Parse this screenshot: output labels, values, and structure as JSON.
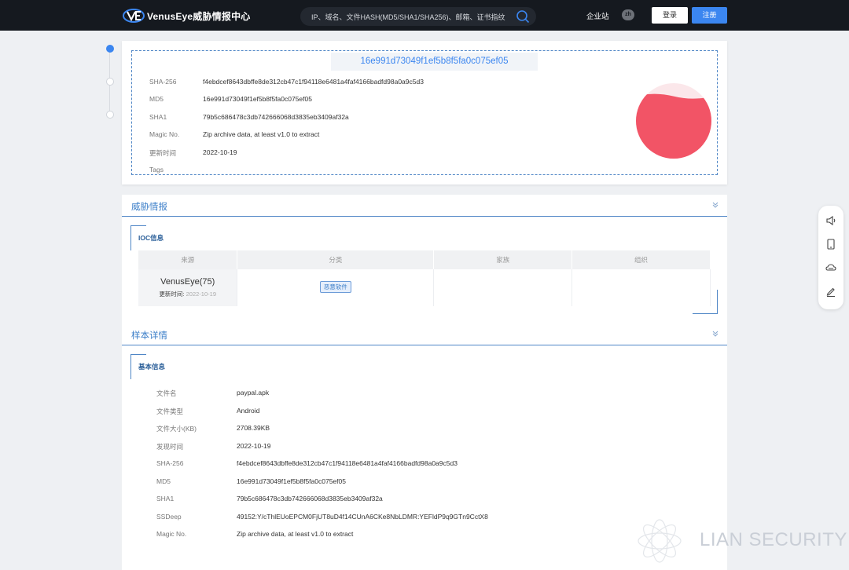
{
  "header": {
    "logo_text": "VenusEye威胁情报中心",
    "search_placeholder": "IP、域名、文件HASH(MD5/SHA1/SHA256)、邮箱、证书指纹",
    "enterprise_label": "企业站",
    "lang_label": "zh",
    "login_label": "登录",
    "register_label": "注册"
  },
  "summary": {
    "hash_title": "16e991d73049f1ef5b8f5fa0c075ef05",
    "rows": [
      {
        "key": "SHA-256",
        "value": "f4ebdcef8643dbffe8de312cb47c1f94118e6481a4faf4166badfd98a0a9c5d3"
      },
      {
        "key": "MD5",
        "value": "16e991d73049f1ef5b8f5fa0c075ef05"
      },
      {
        "key": "SHA1",
        "value": "79b5c686478c3db742666068d3835eb3409af32a"
      },
      {
        "key": "Magic No.",
        "value": "Zip archive data, at least v1.0 to extract"
      },
      {
        "key": "更新时间",
        "value": "2022-10-19"
      },
      {
        "key": "Tags",
        "value": ""
      }
    ],
    "gauge_color": "#f25466",
    "gauge_fill_fraction": 0.82
  },
  "threat": {
    "section_title": "威胁情报",
    "ioc_title": "IOC信息",
    "columns": [
      "来源",
      "分类",
      "家族",
      "组织"
    ],
    "row": {
      "source": "VenusEye(75)",
      "updated_label": "更新时间:",
      "updated_value": "2022-10-19",
      "category_tag": "恶意软件",
      "family": "",
      "organization": ""
    }
  },
  "sample": {
    "section_title": "样本详情",
    "basic_title": "基本信息",
    "rows": [
      {
        "key": "文件名",
        "value": "paypal.apk"
      },
      {
        "key": "文件类型",
        "value": "Android"
      },
      {
        "key": "文件大小(KB)",
        "value": "2708.39KB"
      },
      {
        "key": "发现时间",
        "value": "2022-10-19"
      },
      {
        "key": "SHA-256",
        "value": "f4ebdcef8643dbffe8de312cb47c1f94118e6481a4faf4166badfd98a0a9c5d3"
      },
      {
        "key": "MD5",
        "value": "16e991d73049f1ef5b8f5fa0c075ef05"
      },
      {
        "key": "SHA1",
        "value": "79b5c686478c3db742666068d3835eb3409af32a"
      },
      {
        "key": "SSDeep",
        "value": "49152:Y/cThlEUoEPCM0FjUT8uD4f14CUnA6CKe8NbLDMR:YEFldP9q9GTn9CctX8"
      },
      {
        "key": "Magic No.",
        "value": "Zip archive data, at least v1.0 to extract"
      }
    ]
  },
  "watermark": {
    "text": "LIAN SECURITY"
  },
  "colors": {
    "accent": "#3b86f0",
    "nav_bg": "#15191f",
    "section_line": "#4f86c6"
  },
  "icons": {
    "float_bar": [
      "speaker-icon",
      "tablet-icon",
      "cloud-icon",
      "edit-icon"
    ]
  }
}
